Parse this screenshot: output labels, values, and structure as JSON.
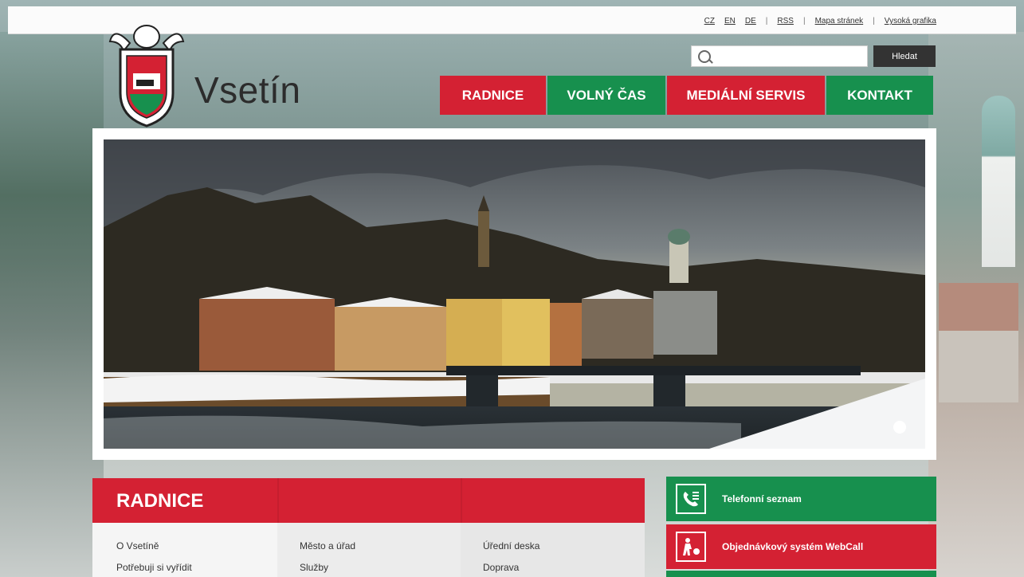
{
  "top_links": {
    "cz": "CZ",
    "en": "EN",
    "de": "DE",
    "rss": "RSS",
    "sitemap": "Mapa stránek",
    "high_contrast": "Vysoká grafika"
  },
  "logo": {
    "name": "Vsetín"
  },
  "search": {
    "placeholder": "",
    "button": "Hledat"
  },
  "nav": [
    {
      "label": "RADNICE",
      "color": "#d42133"
    },
    {
      "label": "VOLNÝ ČAS",
      "color": "#17904e"
    },
    {
      "label": "MEDIÁLNÍ SERVIS",
      "color": "#d42133"
    },
    {
      "label": "KONTAKT",
      "color": "#17904e"
    }
  ],
  "panel": {
    "title": "RADNICE",
    "col1": [
      "O Vsetíně",
      "Potřebuji si vyřídit"
    ],
    "col2": [
      "Město a úřad",
      "Služby"
    ],
    "col3": [
      "Úřední deska",
      "Doprava"
    ]
  },
  "side": [
    {
      "label": "Telefonní seznam",
      "icon": "phone-book-icon"
    },
    {
      "label": "Objednávkový systém WebCall",
      "icon": "person-queue-icon"
    }
  ],
  "colors": {
    "red": "#d42133",
    "green": "#17904e",
    "dark": "#333333"
  }
}
